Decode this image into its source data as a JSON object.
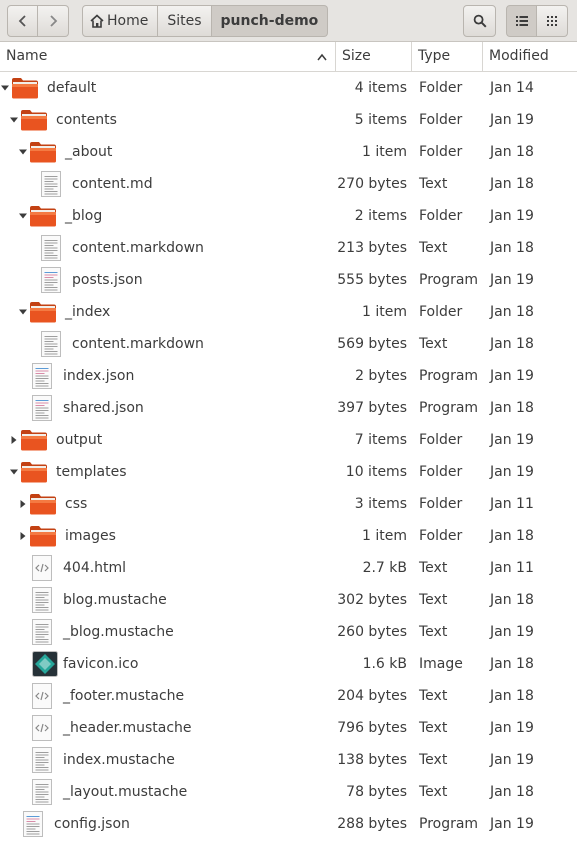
{
  "toolbar": {
    "back_icon": "chevron-left-icon",
    "forward_icon": "chevron-right-icon",
    "breadcrumbs": [
      "Home",
      "Sites",
      "punch-demo"
    ],
    "search_icon": "search-icon",
    "list_view_icon": "list-view-icon",
    "grid_view_icon": "grid-view-icon"
  },
  "columns": {
    "name": "Name",
    "size": "Size",
    "type": "Type",
    "modified": "Modified"
  },
  "colors": {
    "folder": "#e95420",
    "accent": "#dedbd7"
  },
  "rows": [
    {
      "name": "default",
      "size": "4 items",
      "type": "Folder",
      "modified": "Jan 14",
      "level": 0,
      "kind": "folder",
      "expander": "down"
    },
    {
      "name": "contents",
      "size": "5 items",
      "type": "Folder",
      "modified": "Jan 19",
      "level": 1,
      "kind": "folder",
      "expander": "down"
    },
    {
      "name": "_about",
      "size": "1 item",
      "type": "Folder",
      "modified": "Jan 18",
      "level": 2,
      "kind": "folder",
      "expander": "down"
    },
    {
      "name": "content.md",
      "size": "270 bytes",
      "type": "Text",
      "modified": "Jan 18",
      "level": 3,
      "kind": "text",
      "expander": "none"
    },
    {
      "name": "_blog",
      "size": "2 items",
      "type": "Folder",
      "modified": "Jan 19",
      "level": 2,
      "kind": "folder",
      "expander": "down"
    },
    {
      "name": "content.markdown",
      "size": "213 bytes",
      "type": "Text",
      "modified": "Jan 18",
      "level": 3,
      "kind": "text",
      "expander": "none"
    },
    {
      "name": "posts.json",
      "size": "555 bytes",
      "type": "Program",
      "modified": "Jan 19",
      "level": 3,
      "kind": "program",
      "expander": "none"
    },
    {
      "name": "_index",
      "size": "1 item",
      "type": "Folder",
      "modified": "Jan 18",
      "level": 2,
      "kind": "folder",
      "expander": "down"
    },
    {
      "name": "content.markdown",
      "size": "569 bytes",
      "type": "Text",
      "modified": "Jan 18",
      "level": 3,
      "kind": "text",
      "expander": "none"
    },
    {
      "name": "index.json",
      "size": "2 bytes",
      "type": "Program",
      "modified": "Jan 19",
      "level": 2,
      "kind": "program",
      "expander": "none"
    },
    {
      "name": "shared.json",
      "size": "397 bytes",
      "type": "Program",
      "modified": "Jan 18",
      "level": 2,
      "kind": "program",
      "expander": "none"
    },
    {
      "name": "output",
      "size": "7 items",
      "type": "Folder",
      "modified": "Jan 19",
      "level": 1,
      "kind": "folder",
      "expander": "right"
    },
    {
      "name": "templates",
      "size": "10 items",
      "type": "Folder",
      "modified": "Jan 19",
      "level": 1,
      "kind": "folder",
      "expander": "down"
    },
    {
      "name": "css",
      "size": "3 items",
      "type": "Folder",
      "modified": "Jan 11",
      "level": 2,
      "kind": "folder",
      "expander": "right"
    },
    {
      "name": "images",
      "size": "1 item",
      "type": "Folder",
      "modified": "Jan 18",
      "level": 2,
      "kind": "folder",
      "expander": "right"
    },
    {
      "name": "404.html",
      "size": "2.7 kB",
      "type": "Text",
      "modified": "Jan 11",
      "level": 2,
      "kind": "html",
      "expander": "none"
    },
    {
      "name": "blog.mustache",
      "size": "302 bytes",
      "type": "Text",
      "modified": "Jan 18",
      "level": 2,
      "kind": "text",
      "expander": "none"
    },
    {
      "name": "_blog.mustache",
      "size": "260 bytes",
      "type": "Text",
      "modified": "Jan 19",
      "level": 2,
      "kind": "text",
      "expander": "none"
    },
    {
      "name": "favicon.ico",
      "size": "1.6 kB",
      "type": "Image",
      "modified": "Jan 18",
      "level": 2,
      "kind": "image",
      "expander": "none"
    },
    {
      "name": "_footer.mustache",
      "size": "204 bytes",
      "type": "Text",
      "modified": "Jan 18",
      "level": 2,
      "kind": "html",
      "expander": "none"
    },
    {
      "name": "_header.mustache",
      "size": "796 bytes",
      "type": "Text",
      "modified": "Jan 19",
      "level": 2,
      "kind": "html",
      "expander": "none"
    },
    {
      "name": "index.mustache",
      "size": "138 bytes",
      "type": "Text",
      "modified": "Jan 19",
      "level": 2,
      "kind": "text",
      "expander": "none"
    },
    {
      "name": "_layout.mustache",
      "size": "78 bytes",
      "type": "Text",
      "modified": "Jan 18",
      "level": 2,
      "kind": "text",
      "expander": "none"
    },
    {
      "name": "config.json",
      "size": "288 bytes",
      "type": "Program",
      "modified": "Jan 19",
      "level": 1,
      "kind": "program",
      "expander": "none"
    }
  ]
}
